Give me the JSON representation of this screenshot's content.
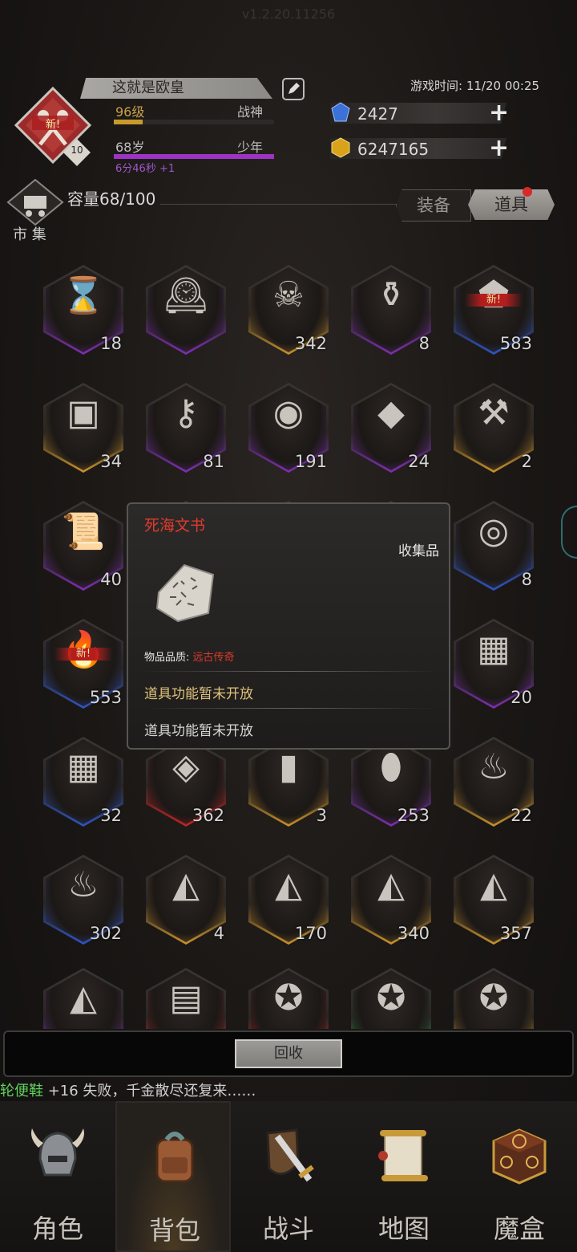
{
  "app": {
    "version": "v1.2.20.11256"
  },
  "player": {
    "name": "这就是欧皇",
    "level_text": "96级",
    "title": "战神",
    "age_text": "68岁",
    "age_stage": "少年",
    "timer_text": "6分46秒 +1",
    "avatar_badge": "10",
    "new_label": "新!",
    "level_progress": 0.18,
    "age_progress": 1.0
  },
  "game_time": "游戏时间: 11/20 00:25",
  "currency": [
    {
      "name": "gem",
      "value": "2427",
      "color": "#3b6fd8"
    },
    {
      "name": "gold",
      "value": "6247165",
      "color": "#d8a21b"
    }
  ],
  "market": {
    "label": "市 集"
  },
  "inventory": {
    "capacity": "容量68/100",
    "tabs": [
      {
        "label": "装备"
      },
      {
        "label": "道具"
      }
    ]
  },
  "items": [
    {
      "icon": "hourglass-icon",
      "glyph": "⌛",
      "count": "18",
      "rarity": "purple"
    },
    {
      "icon": "clock-icon",
      "glyph": "🕰",
      "count": "",
      "rarity": "purple"
    },
    {
      "icon": "skull-icon",
      "glyph": "☠",
      "count": "342",
      "rarity": "gold"
    },
    {
      "icon": "jar-icon",
      "glyph": "⚱",
      "count": "8",
      "rarity": "purple"
    },
    {
      "icon": "stone-icon",
      "glyph": "⬟",
      "count": "583",
      "rarity": "blue",
      "new": true
    },
    {
      "icon": "chest-icon",
      "glyph": "▣",
      "count": "34",
      "rarity": "gold"
    },
    {
      "icon": "key-icon",
      "glyph": "⚷",
      "count": "81",
      "rarity": "purple"
    },
    {
      "icon": "eye-stone-icon",
      "glyph": "◉",
      "count": "191",
      "rarity": "purple"
    },
    {
      "icon": "crystal-icon",
      "glyph": "◆",
      "count": "24",
      "rarity": "purple"
    },
    {
      "icon": "hammer-icon",
      "glyph": "⚒",
      "count": "2",
      "rarity": "gold"
    },
    {
      "icon": "scroll-icon",
      "glyph": "📜",
      "count": "40",
      "rarity": "purple"
    },
    {
      "icon": "hidden-icon",
      "glyph": "",
      "count": "",
      "rarity": "purple"
    },
    {
      "icon": "hidden-icon",
      "glyph": "",
      "count": "",
      "rarity": "purple"
    },
    {
      "icon": "hidden-icon",
      "glyph": "",
      "count": "",
      "rarity": "purple"
    },
    {
      "icon": "bowl-icon",
      "glyph": "◎",
      "count": "8",
      "rarity": "blue"
    },
    {
      "icon": "torch-icon",
      "glyph": "🔥",
      "count": "553",
      "rarity": "blue",
      "new": true
    },
    {
      "icon": "hidden-icon",
      "glyph": "",
      "count": "",
      "rarity": "purple"
    },
    {
      "icon": "hidden-icon",
      "glyph": "",
      "count": "",
      "rarity": "purple"
    },
    {
      "icon": "hidden-icon",
      "glyph": "",
      "count": "",
      "rarity": "purple"
    },
    {
      "icon": "rune-tablet-icon",
      "glyph": "▦",
      "count": "20",
      "rarity": "purple"
    },
    {
      "icon": "rune-tablet-icon",
      "glyph": "▦",
      "count": "32",
      "rarity": "blue"
    },
    {
      "icon": "carved-stone-icon",
      "glyph": "◈",
      "count": "362",
      "rarity": "red"
    },
    {
      "icon": "stone-pillar-icon",
      "glyph": "▮",
      "count": "3",
      "rarity": "gold"
    },
    {
      "icon": "gem-stone-icon",
      "glyph": "⬮",
      "count": "253",
      "rarity": "purple"
    },
    {
      "icon": "flame-icon",
      "glyph": "♨",
      "count": "22",
      "rarity": "gold"
    },
    {
      "icon": "flame-icon",
      "glyph": "♨",
      "count": "302",
      "rarity": "blue"
    },
    {
      "icon": "rune-stone-icon",
      "glyph": "◭",
      "count": "4",
      "rarity": "gold"
    },
    {
      "icon": "rune-stone-icon",
      "glyph": "◭",
      "count": "170",
      "rarity": "gold"
    },
    {
      "icon": "rune-stone-icon",
      "glyph": "◭",
      "count": "340",
      "rarity": "gold"
    },
    {
      "icon": "rune-stone-icon",
      "glyph": "◭",
      "count": "357",
      "rarity": "gold"
    },
    {
      "icon": "rune-stone-icon",
      "glyph": "◭",
      "count": "",
      "rarity": "purple"
    },
    {
      "icon": "paper-icon",
      "glyph": "▤",
      "count": "",
      "rarity": "red"
    },
    {
      "icon": "medal-icon",
      "glyph": "✪",
      "count": "",
      "rarity": "red"
    },
    {
      "icon": "medal-icon",
      "glyph": "✪",
      "count": "",
      "rarity": "green"
    },
    {
      "icon": "medal-icon",
      "glyph": "✪",
      "count": "",
      "rarity": "gold"
    }
  ],
  "tooltip": {
    "title": "死海文书",
    "category": "收集品",
    "quality_label": "物品品质: ",
    "quality_value": "远古传奇",
    "function_title": "道具功能暂未开放",
    "function_desc": "道具功能暂未开放"
  },
  "recycle_label": "回收",
  "ticker": {
    "highlight": "轮便鞋",
    "text": " +16 失败，千金散尽还复来……"
  },
  "nav": [
    {
      "label": "角色",
      "icon": "helmet-icon"
    },
    {
      "label": "背包",
      "icon": "backpack-icon"
    },
    {
      "label": "战斗",
      "icon": "sword-shield-icon"
    },
    {
      "label": "地图",
      "icon": "map-scroll-icon"
    },
    {
      "label": "魔盒",
      "icon": "magic-box-icon"
    }
  ],
  "colors": {
    "purple": "#7d2fb3",
    "blue": "#2f55c4",
    "gold": "#c9922b",
    "red": "#c22424",
    "green": "#2a8f46",
    "accent_red": "#e03b2c"
  }
}
